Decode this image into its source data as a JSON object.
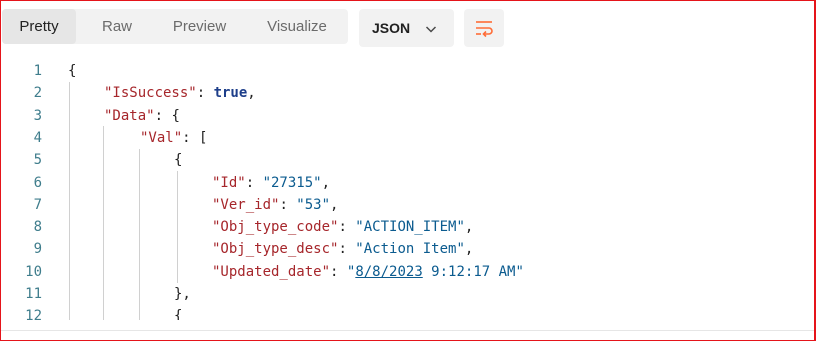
{
  "tabs": [
    "Pretty",
    "Raw",
    "Preview",
    "Visualize"
  ],
  "active_tab": "Pretty",
  "format_selector": {
    "value": "JSON"
  },
  "icons": {
    "format_dropdown": "chevron-down-icon",
    "wrap_button": "wrap-lines-icon",
    "accent_color": "#ff6c37"
  },
  "line_numbers": [
    "1",
    "2",
    "3",
    "4",
    "5",
    "6",
    "7",
    "8",
    "9",
    "10",
    "11",
    "12"
  ],
  "code": {
    "l1": {
      "punct": "{"
    },
    "l2": {
      "key": "\"IsSuccess\"",
      "sep": ": ",
      "value": "true",
      "end": ","
    },
    "l3": {
      "key": "\"Data\"",
      "sep": ": ",
      "end": "{"
    },
    "l4": {
      "key": "\"Val\"",
      "sep": ": ",
      "end": "["
    },
    "l5": {
      "punct": "{"
    },
    "l6": {
      "key": "\"Id\"",
      "sep": ": ",
      "value": "\"27315\"",
      "end": ","
    },
    "l7": {
      "key": "\"Ver_id\"",
      "sep": ": ",
      "value": "\"53\"",
      "end": ","
    },
    "l8": {
      "key": "\"Obj_type_code\"",
      "sep": ": ",
      "value": "\"ACTION_ITEM\"",
      "end": ","
    },
    "l9": {
      "key": "\"Obj_type_desc\"",
      "sep": ": ",
      "value": "\"Action Item\"",
      "end": ","
    },
    "l10": {
      "key": "\"Updated_date\"",
      "sep": ": ",
      "value_quote": "\"",
      "value_date": "8/8/2023",
      "value_rest": " 9:12:17 AM\""
    },
    "l11": {
      "punct": "},"
    },
    "l12": {
      "punct": "{"
    }
  },
  "colors": {
    "key": "#a6262b",
    "string": "#0b5b8f",
    "boolean": "#1d3e8a",
    "line_number": "#3f7d8c",
    "frame": "#e5141a"
  }
}
